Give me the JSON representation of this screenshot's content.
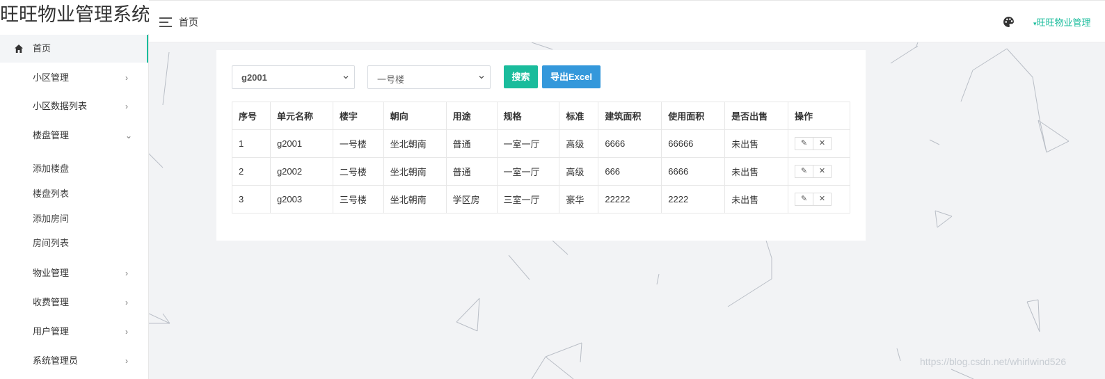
{
  "app": {
    "title": "旺旺物业管理系统"
  },
  "header": {
    "breadcrumb": "首页",
    "user": "旺旺物业管理"
  },
  "sidebar": {
    "home": "首页",
    "items": [
      {
        "label": "小区管理",
        "arrow": "›"
      },
      {
        "label": "小区数据列表",
        "arrow": "›"
      },
      {
        "label": "楼盘管理",
        "arrow": "⌄"
      },
      {
        "label": "物业管理",
        "arrow": "›"
      },
      {
        "label": "收费管理",
        "arrow": "›"
      },
      {
        "label": "用户管理",
        "arrow": "›"
      },
      {
        "label": "系统管理员",
        "arrow": "›"
      }
    ],
    "subitems": [
      "添加楼盘",
      "楼盘列表",
      "添加房间",
      "房间列表"
    ]
  },
  "filters": {
    "unit_select": "g2001",
    "building_select": "一号楼"
  },
  "buttons": {
    "search": "搜索",
    "export": "导出Excel"
  },
  "table": {
    "headers": [
      "序号",
      "单元名称",
      "楼宇",
      "朝向",
      "用途",
      "规格",
      "标准",
      "建筑面积",
      "使用面积",
      "是否出售",
      "操作"
    ],
    "rows": [
      [
        "1",
        "g2001",
        "一号楼",
        "坐北朝南",
        "普通",
        "一室一厅",
        "高级",
        "6666",
        "66666",
        "未出售"
      ],
      [
        "2",
        "g2002",
        "二号楼",
        "坐北朝南",
        "普通",
        "一室一厅",
        "高级",
        "666",
        "6666",
        "未出售"
      ],
      [
        "3",
        "g2003",
        "三号楼",
        "坐北朝南",
        "学区房",
        "三室一厅",
        "豪华",
        "22222",
        "2222",
        "未出售"
      ]
    ],
    "actions": {
      "edit": "✎",
      "delete": "✕"
    }
  },
  "watermark": "https://blog.csdn.net/whirlwind526",
  "colors": {
    "accent": "#1abc9c",
    "blue": "#3498db",
    "main_bg": "#f2f3f5"
  }
}
